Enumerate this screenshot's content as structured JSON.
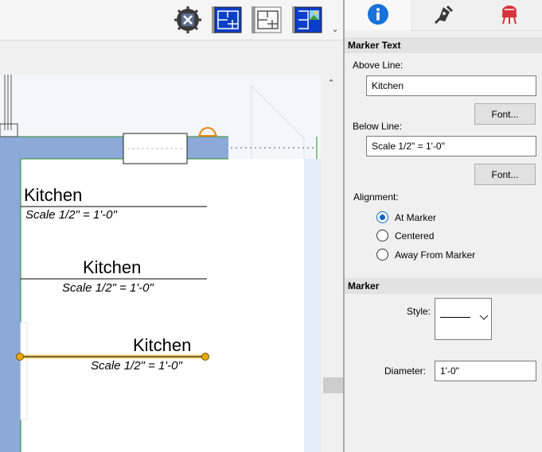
{
  "toolbar": {
    "buttons": [
      {
        "icon": "gear-chip-icon"
      },
      {
        "icon": "floor-plan-blue-icon"
      },
      {
        "icon": "floor-plan-gray-icon"
      },
      {
        "icon": "floor-plan-picture-icon"
      }
    ],
    "more_icon": "chevron-down-icon",
    "more_glyph": "⌄"
  },
  "canvas": {
    "markers": [
      {
        "above": "Kitchen",
        "below": "Scale 1/2\" = 1'-0\"",
        "alignment": "At Marker"
      },
      {
        "above": "Kitchen",
        "below": "Scale 1/2\" = 1'-0\"",
        "alignment": "Centered"
      },
      {
        "above": "Kitchen",
        "below": "Scale 1/2\" = 1'-0\"",
        "alignment": "Away From Marker",
        "selected": true
      }
    ],
    "wall_color": "#8da9d8",
    "selection_color": "#e8a800",
    "scroll_up_glyph": "⌃"
  },
  "panel": {
    "tabs": [
      {
        "icon": "info-icon",
        "active": true
      },
      {
        "icon": "pen-nib-icon",
        "active": false
      },
      {
        "icon": "material-chair-icon",
        "active": false
      }
    ],
    "marker_text_header": "Marker Text",
    "above_line_label": "Above Line:",
    "above_line_value": "Kitchen",
    "font_button_1": "Font...",
    "below_line_label": "Below Line:",
    "below_line_value": "Scale 1/2\" = 1'-0\"",
    "font_button_2": "Font...",
    "alignment_label": "Alignment:",
    "alignment_options": [
      "At Marker",
      "Centered",
      "Away From Marker"
    ],
    "alignment_selected": "At Marker",
    "marker_header": "Marker",
    "style_label": "Style:",
    "diameter_label": "Diameter:",
    "diameter_value": "1'-0\"",
    "accent_color": "#0a64c8"
  }
}
